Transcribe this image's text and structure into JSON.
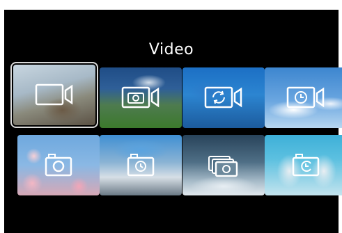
{
  "page": {
    "title": "Video"
  },
  "modes": [
    {
      "icon": "video-camera-icon",
      "selected": true
    },
    {
      "icon": "video-camera-photo-icon",
      "selected": false
    },
    {
      "icon": "video-camera-loop-icon",
      "selected": false
    },
    {
      "icon": "video-camera-timelapse-icon",
      "selected": false
    },
    {
      "icon": "camera-icon",
      "selected": false
    },
    {
      "icon": "camera-timer-icon",
      "selected": false
    },
    {
      "icon": "camera-burst-icon",
      "selected": false
    },
    {
      "icon": "camera-timelapse-icon",
      "selected": false
    }
  ],
  "colors": {
    "background": "#000000",
    "title_text": "#ffffff",
    "selection_border": "#d9d9d9",
    "icon_stroke": "#ffffff"
  }
}
